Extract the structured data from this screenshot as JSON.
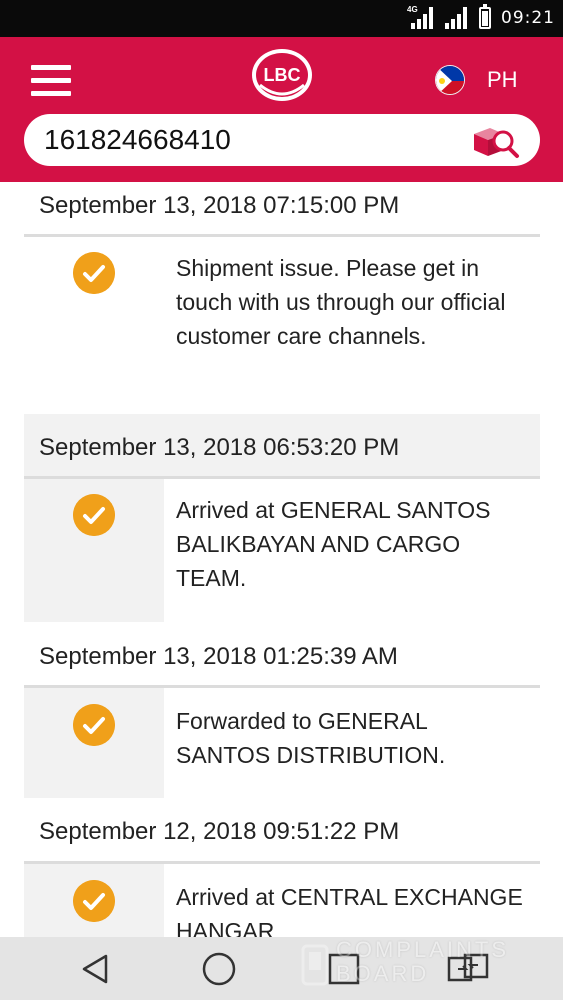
{
  "status_bar": {
    "time": "09:21",
    "network_label": "4G"
  },
  "header": {
    "logo_text": "LBC",
    "country": "PH"
  },
  "search": {
    "value": "161824668410",
    "placeholder": ""
  },
  "tracking": {
    "entries": [
      {
        "date": "September 13, 2018 07:15:00 PM",
        "description": "Shipment issue. Please get in touch with us through our official customer care channels."
      },
      {
        "date": "September 13, 2018 06:53:20 PM",
        "description": "Arrived at GENERAL SANTOS BALIKBAYAN AND CARGO TEAM."
      },
      {
        "date": "September 13, 2018 01:25:39 AM",
        "description": "Forwarded to GENERAL SANTOS DISTRIBUTION."
      },
      {
        "date": "September 12, 2018 09:51:22 PM",
        "description": "Arrived at CENTRAL EXCHANGE HANGAR"
      }
    ]
  },
  "watermark": {
    "line1": "COMPLAINTS",
    "line2": "BOARD"
  },
  "colors": {
    "brand": "#d31145",
    "check": "#f0a01a",
    "alt_row": "#f2f2f2"
  },
  "icons": {
    "menu": "hamburger-menu-icon",
    "search": "package-search-icon",
    "check": "check-circle-icon",
    "back": "back-triangle-icon",
    "home": "home-circle-icon",
    "recents": "recents-square-icon",
    "switch": "switch-apps-icon"
  }
}
